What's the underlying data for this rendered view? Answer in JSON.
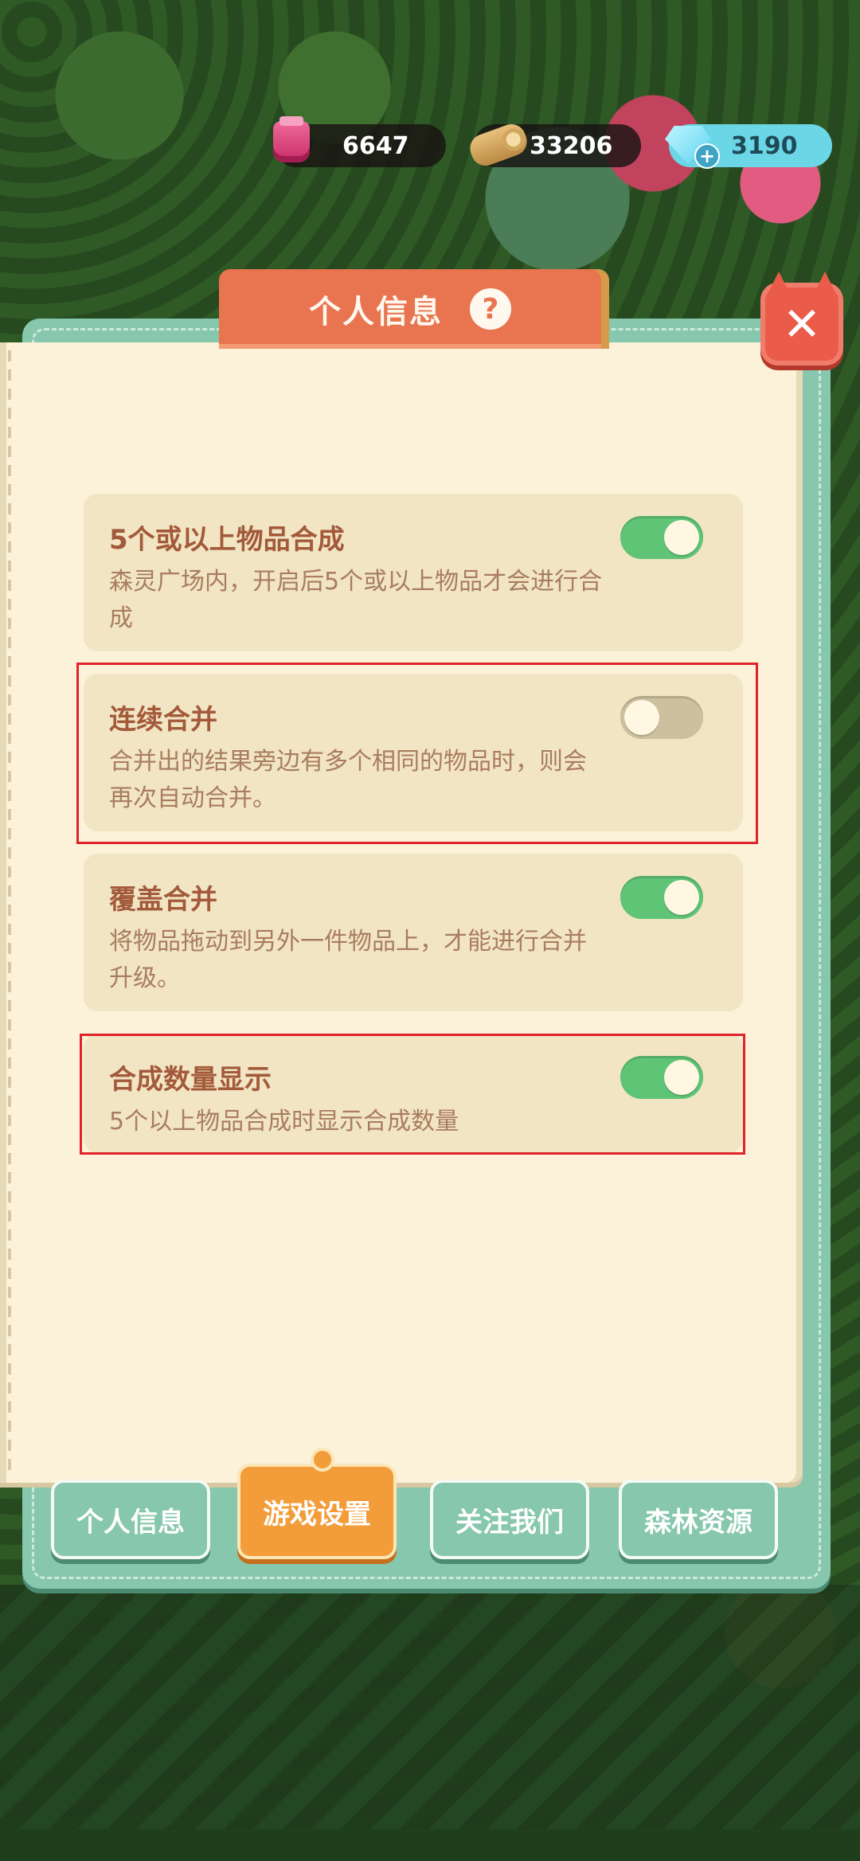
{
  "resources": {
    "potion": {
      "icon": "potion-jar-icon",
      "value": "6647"
    },
    "wood": {
      "icon": "wood-log-icon",
      "value": "33206"
    },
    "gems": {
      "icon": "gem-icon",
      "value": "3190",
      "add": "+"
    }
  },
  "dialog": {
    "title": "个人信息",
    "help": "?",
    "close": "✕"
  },
  "settings": [
    {
      "title": "5个或以上物品合成",
      "desc": "森灵广场内，开启后5个或以上物品才会进行合成",
      "enabled": true
    },
    {
      "title": "连续合并",
      "desc": "合并出的结果旁边有多个相同的物品时，则会再次自动合并。",
      "enabled": false
    },
    {
      "title": "覆盖合并",
      "desc": "将物品拖动到另外一件物品上，才能进行合并升级。",
      "enabled": true
    },
    {
      "title": "合成数量显示",
      "desc": "5个以上物品合成时显示合成数量",
      "enabled": true
    }
  ],
  "tabs": [
    {
      "label": "个人信息",
      "active": false
    },
    {
      "label": "游戏设置",
      "active": true
    },
    {
      "label": "关注我们",
      "active": false
    },
    {
      "label": "森林资源",
      "active": false
    }
  ],
  "colors": {
    "accent": "#e87450",
    "toggle_on": "#5fc476",
    "toggle_off": "#ccc09e",
    "highlight": "#e0232a"
  }
}
